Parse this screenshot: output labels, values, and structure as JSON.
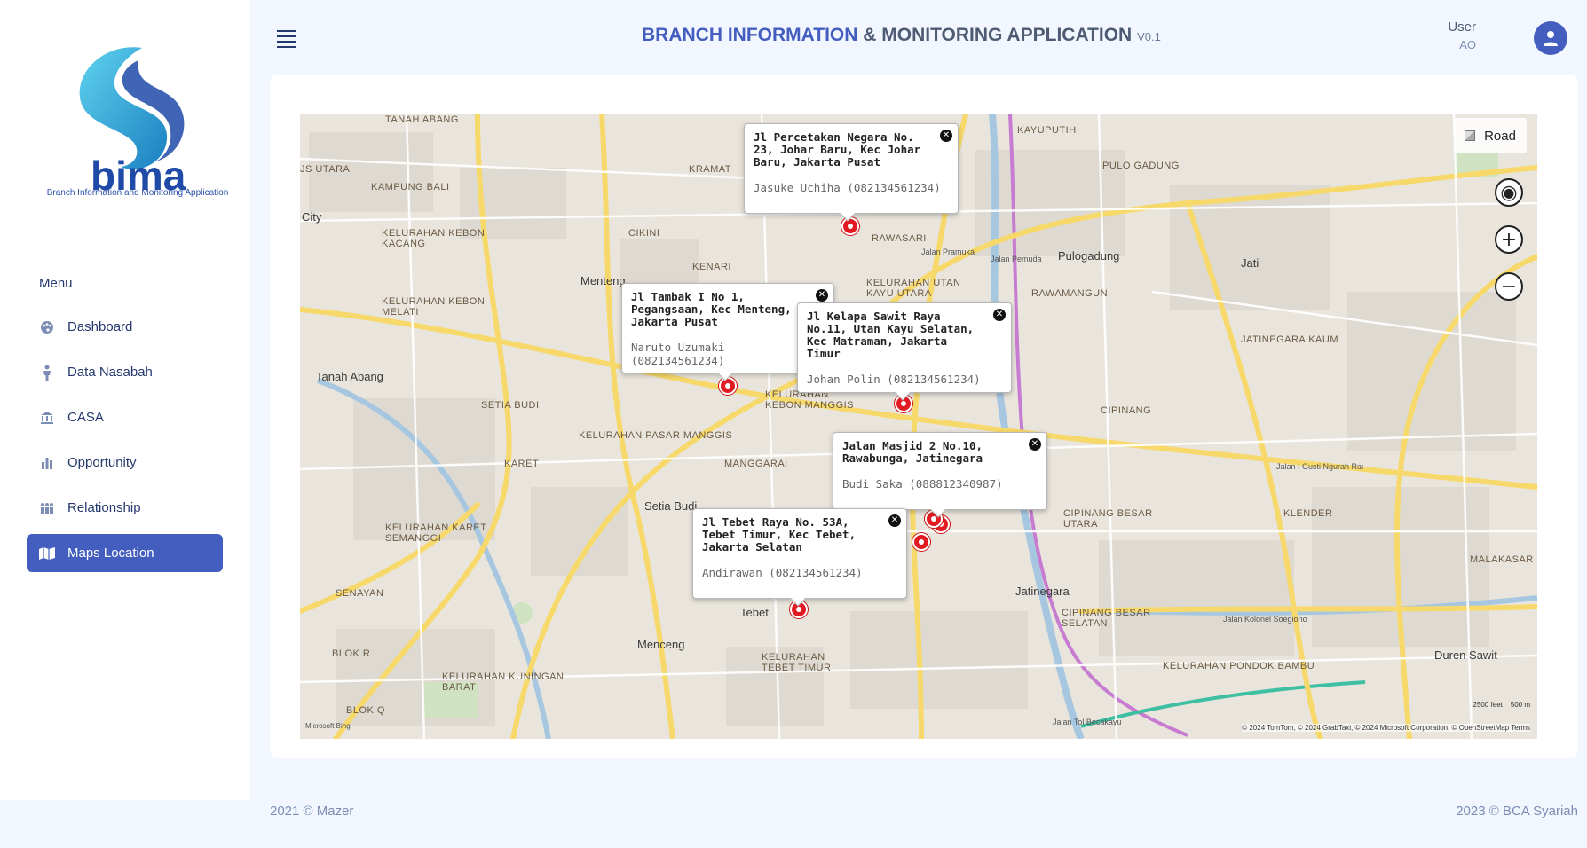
{
  "brand": {
    "logo_text": "bima",
    "logo_subtitle": "Branch Information and Monitoring Application",
    "colors": {
      "primary": "#435ebe",
      "logo_cyan": "#29b6d8",
      "logo_blue": "#1f4aa8"
    }
  },
  "header": {
    "title_part1": "BRANCH INFORMATION",
    "title_part2": "& MONITORING APPLICATION",
    "version": "V0.1",
    "user_name": "User",
    "user_role": "AO"
  },
  "sidebar": {
    "menu_title": "Menu",
    "items": [
      {
        "label": "Dashboard",
        "icon": "palette-icon",
        "active": false
      },
      {
        "label": "Data Nasabah",
        "icon": "person-icon",
        "active": false
      },
      {
        "label": "CASA",
        "icon": "bank-icon",
        "active": false
      },
      {
        "label": "Opportunity",
        "icon": "bar-chart-icon",
        "active": false
      },
      {
        "label": "Relationship",
        "icon": "people-icon",
        "active": false
      },
      {
        "label": "Maps Location",
        "icon": "map-icon",
        "active": true
      }
    ]
  },
  "map": {
    "layer_button": "Road",
    "attribution": "© 2024 TomTom, © 2024 GrabTaxi, © 2024 Microsoft Corporation, © OpenStreetMap  Terms",
    "scale_feet": "2500 feet",
    "scale_m": "500 m",
    "provider_logo": "Microsoft Bing",
    "labels": {
      "tanah_abang_top": "TANAH ABANG",
      "kampung_bali": "KAMPUNG BALI",
      "kebon_kacang": "KELURAHAN KEBON KACANG",
      "kebon_melati": "KELURAHAN KEBON MELATI",
      "tanah_abang": "Tanah Abang",
      "menteng": "Menteng",
      "kenari": "KENARI",
      "cikini": "CIKINI",
      "kramat": "KRAMAT",
      "rawasari": "RAWASARI",
      "utan_kayu": "KELURAHAN UTAN KAYU UTARA",
      "pulogadung": "Pulogadung",
      "pulo_gadung": "PULO GADUNG",
      "jati": "Jati",
      "rawamangun": "RAWAMANGUN",
      "jatinegara_kaum": "JATINEGARA KAUM",
      "setia_budi_caps": "SETIA BUDI",
      "pasar_manggis": "KELURAHAN PASAR MANGGIS",
      "kebon_manggis": "KELURAHAN KEBON MANGGIS",
      "cipinang": "CIPINANG",
      "karet": "KARET",
      "manggarai": "MANGGARAI",
      "setia_budi": "Setia Budi",
      "karet_semanggi": "KELURAHAN KARET SEMANGGI",
      "senayan": "SENAYAN",
      "tebet": "Tebet",
      "menceng": "Menceng",
      "tebet_timur": "KELURAHAN TEBET TIMUR",
      "kuningan_barat": "KELURAHAN KUNINGAN BARAT",
      "blok_q": "BLOK Q",
      "blok_r": "BLOK R",
      "jatinegara": "Jatinegara",
      "cipinang_besar_utara": "CIPINANG BESAR UTARA",
      "cipinang_besar_selatan": "CIPINANG BESAR SELATAN",
      "klender": "KLENDER",
      "pondok_bambu": "KELURAHAN PONDOK BAMBU",
      "duren_sawit": "Duren Sawit",
      "malakasari": "MALAKASAR",
      "kayuputih": "KAYUPUTIH",
      "city": "City",
      "us_utara": "JS UTARA",
      "jalan_tol": "Jalan Tol Becakayu",
      "kolonel_soegiono": "Jalan Kolonel Soegiono",
      "i_gusti": "Jalan I Gusti Ngurah Rai",
      "pemuda": "Jalan Pemuda",
      "pramuka": "Jalan Pramuka"
    },
    "popups": [
      {
        "address": "Jl Percetakan Negara No. 23, Johar Baru, Kec Johar Baru, Jakarta Pusat",
        "contact": "Jasuke Uchiha (082134561234)"
      },
      {
        "address": "Jl Tambak I No 1, Pegangsaan, Kec Menteng, Jakarta Pusat",
        "contact": "Naruto Uzumaki (082134561234)"
      },
      {
        "address": "Jl Kelapa Sawit Raya No.11, Utan Kayu Selatan, Kec Matraman, Jakarta Timur",
        "contact": "Johan Polin (082134561234)"
      },
      {
        "address": "Jalan Masjid 2 No.10, Rawabunga, Jatinegara",
        "contact": "Budi Saka (088812340987)"
      },
      {
        "address": "Jl Tebet Raya No. 53A, Tebet Timur, Kec Tebet, Jakarta Selatan",
        "contact": "Andirawan (082134561234)"
      }
    ]
  },
  "footer": {
    "left": "2021 © Mazer",
    "right": "2023 © BCA Syariah"
  }
}
